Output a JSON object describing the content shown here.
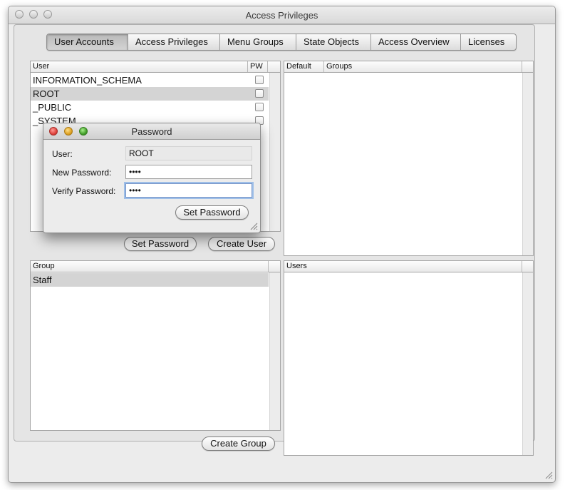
{
  "window": {
    "title": "Access Privileges"
  },
  "tabs": [
    "User Accounts",
    "Access Privileges",
    "Menu Groups",
    "State Objects",
    "Access Overview",
    "Licenses"
  ],
  "users_table": {
    "col_user": "User",
    "col_pw": "PW",
    "rows": [
      "INFORMATION_SCHEMA",
      "ROOT",
      "_PUBLIC",
      "_SYSTEM"
    ]
  },
  "groups_table": {
    "col_default": "Default",
    "col_groups": "Groups"
  },
  "group_table": {
    "col_group": "Group",
    "rows": [
      "Staff"
    ]
  },
  "group_users_table": {
    "col_users": "Users"
  },
  "buttons": {
    "set_password": "Set Password",
    "create_user": "Create User",
    "create_group": "Create Group"
  },
  "password_dialog": {
    "title": "Password",
    "user_label": "User:",
    "user_value": "ROOT",
    "new_password_label": "New Password:",
    "new_password_value": "••••",
    "verify_password_label": "Verify Password:",
    "verify_password_value": "••••",
    "set_password_button": "Set Password"
  },
  "colors": {
    "close": "#e0443e",
    "minimize": "#dea123",
    "zoom": "#45a02c",
    "selection": "#d4d4d4",
    "focus_ring": "#9ebfe8"
  }
}
